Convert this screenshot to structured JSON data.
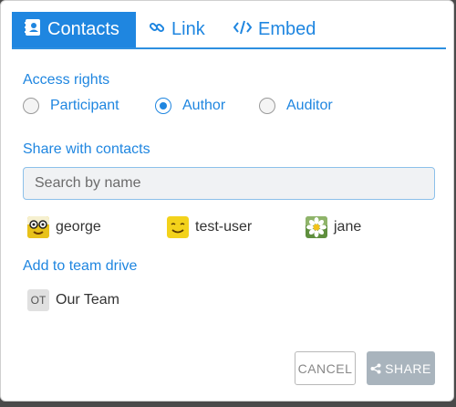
{
  "tabs": [
    {
      "label": "Contacts",
      "icon": "contact-card-icon",
      "active": true
    },
    {
      "label": "Link",
      "icon": "link-icon",
      "active": false
    },
    {
      "label": "Embed",
      "icon": "code-icon",
      "active": false
    }
  ],
  "access": {
    "title": "Access rights",
    "options": [
      {
        "label": "Participant",
        "checked": false
      },
      {
        "label": "Author",
        "checked": true
      },
      {
        "label": "Auditor",
        "checked": false
      }
    ]
  },
  "share": {
    "title": "Share with contacts",
    "search_placeholder": "Search by name",
    "search_value": "",
    "contacts": [
      {
        "name": "george",
        "avatar": "glasses-face-icon"
      },
      {
        "name": "test-user",
        "avatar": "smiley-face-icon"
      },
      {
        "name": "jane",
        "avatar": "daisy-flower-icon"
      }
    ]
  },
  "team_drive": {
    "title": "Add to team drive",
    "teams": [
      {
        "initials": "OT",
        "name": "Our Team"
      }
    ]
  },
  "buttons": {
    "cancel": "CANCEL",
    "share": "SHARE"
  },
  "colors": {
    "accent": "#1f86e0",
    "share_button": "#a9b4bd"
  }
}
